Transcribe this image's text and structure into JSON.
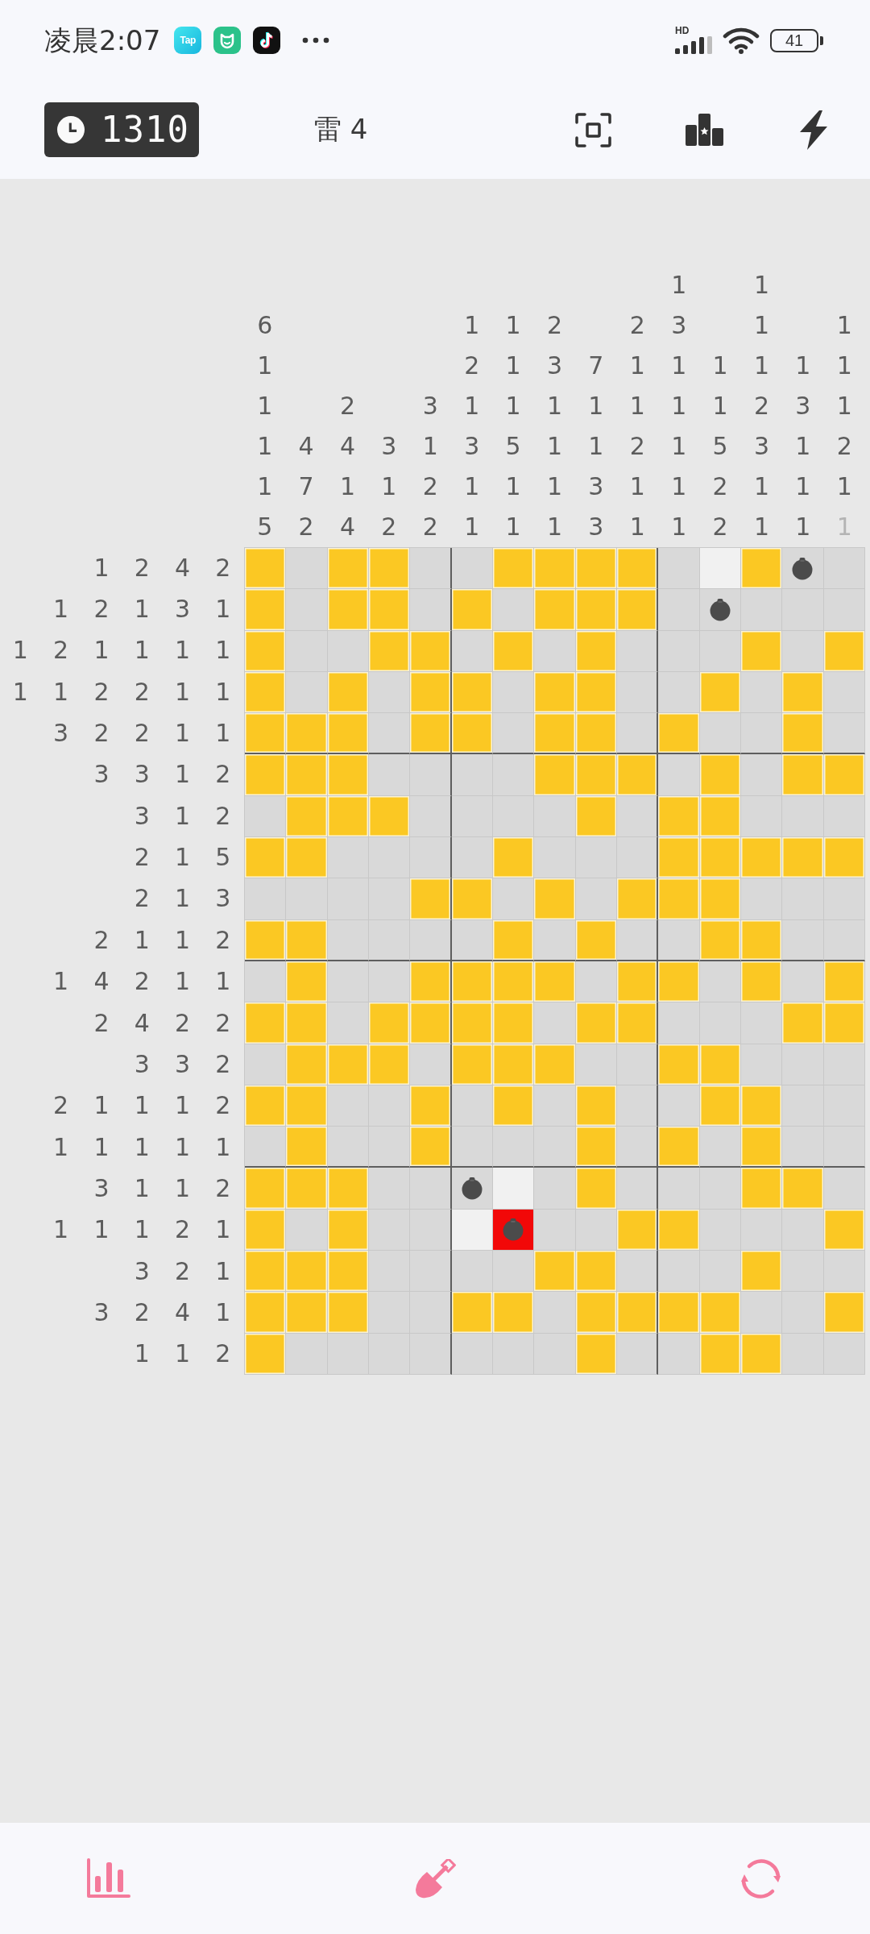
{
  "status_bar": {
    "time": "凌晨2:07",
    "app_label": "Tap",
    "network": "HD",
    "battery": "41"
  },
  "header": {
    "timer": "1310",
    "mines": "雷 4"
  },
  "puzzle": {
    "columns": [
      {
        "clues": [
          {
            "n": "6",
            "done": false
          },
          {
            "n": "1",
            "done": false
          },
          {
            "n": "1",
            "done": false
          },
          {
            "n": "1",
            "done": false
          },
          {
            "n": "1",
            "done": false
          },
          {
            "n": "5",
            "done": false
          }
        ]
      },
      {
        "clues": [
          {
            "n": "4",
            "done": false
          },
          {
            "n": "7",
            "done": false
          },
          {
            "n": "2",
            "done": false
          }
        ]
      },
      {
        "clues": [
          {
            "n": "2",
            "done": false
          },
          {
            "n": "4",
            "done": false
          },
          {
            "n": "1",
            "done": false
          },
          {
            "n": "4",
            "done": false
          }
        ]
      },
      {
        "clues": [
          {
            "n": "3",
            "done": false
          },
          {
            "n": "1",
            "done": false
          },
          {
            "n": "2",
            "done": false
          }
        ]
      },
      {
        "clues": [
          {
            "n": "3",
            "done": false
          },
          {
            "n": "1",
            "done": false
          },
          {
            "n": "2",
            "done": false
          },
          {
            "n": "2",
            "done": false
          }
        ]
      },
      {
        "clues": [
          {
            "n": "1",
            "done": false
          },
          {
            "n": "2",
            "done": false
          },
          {
            "n": "1",
            "done": false
          },
          {
            "n": "3",
            "done": false
          },
          {
            "n": "1",
            "done": false
          },
          {
            "n": "1",
            "done": false
          }
        ]
      },
      {
        "clues": [
          {
            "n": "1",
            "done": false
          },
          {
            "n": "1",
            "done": false
          },
          {
            "n": "1",
            "done": false
          },
          {
            "n": "5",
            "done": false
          },
          {
            "n": "1",
            "done": false
          },
          {
            "n": "1",
            "done": false
          }
        ]
      },
      {
        "clues": [
          {
            "n": "2",
            "done": false
          },
          {
            "n": "3",
            "done": false
          },
          {
            "n": "1",
            "done": false
          },
          {
            "n": "1",
            "done": false
          },
          {
            "n": "1",
            "done": false
          },
          {
            "n": "1",
            "done": false
          }
        ]
      },
      {
        "clues": [
          {
            "n": "7",
            "done": false
          },
          {
            "n": "1",
            "done": false
          },
          {
            "n": "1",
            "done": false
          },
          {
            "n": "3",
            "done": false
          },
          {
            "n": "3",
            "done": false
          }
        ]
      },
      {
        "clues": [
          {
            "n": "2",
            "done": false
          },
          {
            "n": "1",
            "done": false
          },
          {
            "n": "1",
            "done": false
          },
          {
            "n": "2",
            "done": false
          },
          {
            "n": "1",
            "done": false
          },
          {
            "n": "1",
            "done": false
          }
        ]
      },
      {
        "clues": [
          {
            "n": "1",
            "done": false
          },
          {
            "n": "3",
            "done": false
          },
          {
            "n": "1",
            "done": false
          },
          {
            "n": "1",
            "done": false
          },
          {
            "n": "1",
            "done": false
          },
          {
            "n": "1",
            "done": false
          },
          {
            "n": "1",
            "done": false
          }
        ]
      },
      {
        "clues": [
          {
            "n": "1",
            "done": false
          },
          {
            "n": "1",
            "done": false
          },
          {
            "n": "5",
            "done": false
          },
          {
            "n": "2",
            "done": false
          },
          {
            "n": "2",
            "done": false
          }
        ]
      },
      {
        "clues": [
          {
            "n": "1",
            "done": false
          },
          {
            "n": "1",
            "done": false
          },
          {
            "n": "1",
            "done": false
          },
          {
            "n": "2",
            "done": false
          },
          {
            "n": "3",
            "done": false
          },
          {
            "n": "1",
            "done": false
          },
          {
            "n": "1",
            "done": false
          }
        ]
      },
      {
        "clues": [
          {
            "n": "1",
            "done": false
          },
          {
            "n": "3",
            "done": false
          },
          {
            "n": "1",
            "done": false
          },
          {
            "n": "1",
            "done": false
          },
          {
            "n": "1",
            "done": false
          }
        ]
      },
      {
        "clues": [
          {
            "n": "1",
            "done": false
          },
          {
            "n": "1",
            "done": false
          },
          {
            "n": "1",
            "done": false
          },
          {
            "n": "2",
            "done": false
          },
          {
            "n": "1",
            "done": false
          },
          {
            "n": "1",
            "done": true
          }
        ]
      }
    ],
    "rows": [
      {
        "clues": [
          {
            "n": "1",
            "done": false
          },
          {
            "n": "2",
            "done": false
          },
          {
            "n": "4",
            "done": false
          },
          {
            "n": "2",
            "done": false
          }
        ],
        "cells": [
          {
            "kind": "filled"
          },
          {
            "kind": "blank"
          },
          {
            "kind": "filled"
          },
          {
            "kind": "filled"
          },
          {
            "kind": "blank"
          },
          {
            "kind": "blank"
          },
          {
            "kind": "filled"
          },
          {
            "kind": "filled"
          },
          {
            "kind": "filled"
          },
          {
            "kind": "filled"
          },
          {
            "kind": "blank"
          },
          {
            "kind": "open"
          },
          {
            "kind": "filled"
          },
          {
            "kind": "mine"
          },
          {
            "kind": "blank"
          }
        ]
      },
      {
        "clues": [
          {
            "n": "1",
            "done": false
          },
          {
            "n": "2",
            "done": false
          },
          {
            "n": "1",
            "done": false
          },
          {
            "n": "3",
            "done": false
          },
          {
            "n": "1",
            "done": false
          }
        ],
        "cells": [
          {
            "kind": "filled"
          },
          {
            "kind": "blank"
          },
          {
            "kind": "filled"
          },
          {
            "kind": "filled"
          },
          {
            "kind": "blank"
          },
          {
            "kind": "filled"
          },
          {
            "kind": "blank"
          },
          {
            "kind": "filled"
          },
          {
            "kind": "filled"
          },
          {
            "kind": "filled"
          },
          {
            "kind": "blank"
          },
          {
            "kind": "mine"
          },
          {
            "kind": "blank"
          },
          {
            "kind": "blank"
          },
          {
            "kind": "blank"
          }
        ]
      },
      {
        "clues": [
          {
            "n": "1",
            "done": false
          },
          {
            "n": "2",
            "done": false
          },
          {
            "n": "1",
            "done": false
          },
          {
            "n": "1",
            "done": false
          },
          {
            "n": "1",
            "done": false
          },
          {
            "n": "1",
            "done": false
          }
        ],
        "cells": [
          {
            "kind": "filled"
          },
          {
            "kind": "blank"
          },
          {
            "kind": "blank"
          },
          {
            "kind": "filled"
          },
          {
            "kind": "filled"
          },
          {
            "kind": "blank"
          },
          {
            "kind": "filled"
          },
          {
            "kind": "blank"
          },
          {
            "kind": "filled"
          },
          {
            "kind": "blank"
          },
          {
            "kind": "blank"
          },
          {
            "kind": "blank"
          },
          {
            "kind": "filled"
          },
          {
            "kind": "blank"
          },
          {
            "kind": "filled"
          }
        ]
      },
      {
        "clues": [
          {
            "n": "1",
            "done": false
          },
          {
            "n": "1",
            "done": false
          },
          {
            "n": "2",
            "done": false
          },
          {
            "n": "2",
            "done": false
          },
          {
            "n": "1",
            "done": false
          },
          {
            "n": "1",
            "done": false
          }
        ],
        "cells": [
          {
            "kind": "filled"
          },
          {
            "kind": "blank"
          },
          {
            "kind": "filled"
          },
          {
            "kind": "blank"
          },
          {
            "kind": "filled"
          },
          {
            "kind": "filled"
          },
          {
            "kind": "blank"
          },
          {
            "kind": "filled"
          },
          {
            "kind": "filled"
          },
          {
            "kind": "blank"
          },
          {
            "kind": "blank"
          },
          {
            "kind": "filled"
          },
          {
            "kind": "blank"
          },
          {
            "kind": "filled"
          },
          {
            "kind": "blank"
          }
        ]
      },
      {
        "clues": [
          {
            "n": "3",
            "done": false
          },
          {
            "n": "2",
            "done": false
          },
          {
            "n": "2",
            "done": false
          },
          {
            "n": "1",
            "done": false
          },
          {
            "n": "1",
            "done": false
          }
        ],
        "cells": [
          {
            "kind": "filled"
          },
          {
            "kind": "filled"
          },
          {
            "kind": "filled"
          },
          {
            "kind": "blank"
          },
          {
            "kind": "filled"
          },
          {
            "kind": "filled"
          },
          {
            "kind": "blank"
          },
          {
            "kind": "filled"
          },
          {
            "kind": "filled"
          },
          {
            "kind": "blank"
          },
          {
            "kind": "filled"
          },
          {
            "kind": "blank"
          },
          {
            "kind": "blank"
          },
          {
            "kind": "filled"
          },
          {
            "kind": "blank"
          }
        ]
      },
      {
        "clues": [
          {
            "n": "3",
            "done": false
          },
          {
            "n": "3",
            "done": false
          },
          {
            "n": "1",
            "done": false
          },
          {
            "n": "2",
            "done": false
          }
        ],
        "cells": [
          {
            "kind": "filled"
          },
          {
            "kind": "filled"
          },
          {
            "kind": "filled"
          },
          {
            "kind": "blank"
          },
          {
            "kind": "blank"
          },
          {
            "kind": "blank"
          },
          {
            "kind": "blank"
          },
          {
            "kind": "filled"
          },
          {
            "kind": "filled"
          },
          {
            "kind": "filled"
          },
          {
            "kind": "blank"
          },
          {
            "kind": "filled"
          },
          {
            "kind": "blank"
          },
          {
            "kind": "filled"
          },
          {
            "kind": "filled"
          }
        ]
      },
      {
        "clues": [
          {
            "n": "3",
            "done": false
          },
          {
            "n": "1",
            "done": false
          },
          {
            "n": "2",
            "done": false
          }
        ],
        "cells": [
          {
            "kind": "blank"
          },
          {
            "kind": "filled"
          },
          {
            "kind": "filled"
          },
          {
            "kind": "filled"
          },
          {
            "kind": "blank"
          },
          {
            "kind": "blank"
          },
          {
            "kind": "blank"
          },
          {
            "kind": "blank"
          },
          {
            "kind": "filled"
          },
          {
            "kind": "blank"
          },
          {
            "kind": "filled"
          },
          {
            "kind": "filled"
          },
          {
            "kind": "blank"
          },
          {
            "kind": "blank"
          },
          {
            "kind": "blank"
          }
        ]
      },
      {
        "clues": [
          {
            "n": "2",
            "done": false
          },
          {
            "n": "1",
            "done": false
          },
          {
            "n": "5",
            "done": false
          }
        ],
        "cells": [
          {
            "kind": "filled"
          },
          {
            "kind": "filled"
          },
          {
            "kind": "blank"
          },
          {
            "kind": "blank"
          },
          {
            "kind": "blank"
          },
          {
            "kind": "blank"
          },
          {
            "kind": "filled"
          },
          {
            "kind": "blank"
          },
          {
            "kind": "blank"
          },
          {
            "kind": "blank"
          },
          {
            "kind": "filled"
          },
          {
            "kind": "filled"
          },
          {
            "kind": "filled"
          },
          {
            "kind": "filled"
          },
          {
            "kind": "filled"
          }
        ]
      },
      {
        "clues": [
          {
            "n": "2",
            "done": false
          },
          {
            "n": "1",
            "done": false
          },
          {
            "n": "3",
            "done": false
          }
        ],
        "cells": [
          {
            "kind": "blank"
          },
          {
            "kind": "blank"
          },
          {
            "kind": "blank"
          },
          {
            "kind": "blank"
          },
          {
            "kind": "filled"
          },
          {
            "kind": "filled"
          },
          {
            "kind": "blank"
          },
          {
            "kind": "filled"
          },
          {
            "kind": "blank"
          },
          {
            "kind": "filled"
          },
          {
            "kind": "filled"
          },
          {
            "kind": "filled"
          },
          {
            "kind": "blank"
          },
          {
            "kind": "blank"
          },
          {
            "kind": "blank"
          }
        ]
      },
      {
        "clues": [
          {
            "n": "2",
            "done": false
          },
          {
            "n": "1",
            "done": false
          },
          {
            "n": "1",
            "done": false
          },
          {
            "n": "2",
            "done": false
          }
        ],
        "cells": [
          {
            "kind": "filled"
          },
          {
            "kind": "filled"
          },
          {
            "kind": "blank"
          },
          {
            "kind": "blank"
          },
          {
            "kind": "blank"
          },
          {
            "kind": "blank"
          },
          {
            "kind": "filled"
          },
          {
            "kind": "blank"
          },
          {
            "kind": "filled"
          },
          {
            "kind": "blank"
          },
          {
            "kind": "blank"
          },
          {
            "kind": "filled"
          },
          {
            "kind": "filled"
          },
          {
            "kind": "blank"
          },
          {
            "kind": "blank"
          }
        ]
      },
      {
        "clues": [
          {
            "n": "1",
            "done": false
          },
          {
            "n": "4",
            "done": false
          },
          {
            "n": "2",
            "done": false
          },
          {
            "n": "1",
            "done": false
          },
          {
            "n": "1",
            "done": false
          }
        ],
        "cells": [
          {
            "kind": "blank"
          },
          {
            "kind": "filled"
          },
          {
            "kind": "blank"
          },
          {
            "kind": "blank"
          },
          {
            "kind": "filled"
          },
          {
            "kind": "filled"
          },
          {
            "kind": "filled"
          },
          {
            "kind": "filled"
          },
          {
            "kind": "blank"
          },
          {
            "kind": "filled"
          },
          {
            "kind": "filled"
          },
          {
            "kind": "blank"
          },
          {
            "kind": "filled"
          },
          {
            "kind": "blank"
          },
          {
            "kind": "filled"
          }
        ]
      },
      {
        "clues": [
          {
            "n": "2",
            "done": false
          },
          {
            "n": "4",
            "done": false
          },
          {
            "n": "2",
            "done": false
          },
          {
            "n": "2",
            "done": false
          }
        ],
        "cells": [
          {
            "kind": "filled"
          },
          {
            "kind": "filled"
          },
          {
            "kind": "blank"
          },
          {
            "kind": "filled"
          },
          {
            "kind": "filled"
          },
          {
            "kind": "filled"
          },
          {
            "kind": "filled"
          },
          {
            "kind": "blank"
          },
          {
            "kind": "filled"
          },
          {
            "kind": "filled"
          },
          {
            "kind": "blank"
          },
          {
            "kind": "blank"
          },
          {
            "kind": "blank"
          },
          {
            "kind": "filled"
          },
          {
            "kind": "filled"
          }
        ]
      },
      {
        "clues": [
          {
            "n": "3",
            "done": false
          },
          {
            "n": "3",
            "done": false
          },
          {
            "n": "2",
            "done": false
          }
        ],
        "cells": [
          {
            "kind": "blank"
          },
          {
            "kind": "filled"
          },
          {
            "kind": "filled"
          },
          {
            "kind": "filled"
          },
          {
            "kind": "blank"
          },
          {
            "kind": "filled"
          },
          {
            "kind": "filled"
          },
          {
            "kind": "filled"
          },
          {
            "kind": "blank"
          },
          {
            "kind": "blank"
          },
          {
            "kind": "filled"
          },
          {
            "kind": "filled"
          },
          {
            "kind": "blank"
          },
          {
            "kind": "blank"
          },
          {
            "kind": "blank"
          }
        ]
      },
      {
        "clues": [
          {
            "n": "2",
            "done": false
          },
          {
            "n": "1",
            "done": false
          },
          {
            "n": "1",
            "done": false
          },
          {
            "n": "1",
            "done": false
          },
          {
            "n": "2",
            "done": false
          }
        ],
        "cells": [
          {
            "kind": "filled"
          },
          {
            "kind": "filled"
          },
          {
            "kind": "blank"
          },
          {
            "kind": "blank"
          },
          {
            "kind": "filled"
          },
          {
            "kind": "blank"
          },
          {
            "kind": "filled"
          },
          {
            "kind": "blank"
          },
          {
            "kind": "filled"
          },
          {
            "kind": "blank"
          },
          {
            "kind": "blank"
          },
          {
            "kind": "filled"
          },
          {
            "kind": "filled"
          },
          {
            "kind": "blank"
          },
          {
            "kind": "blank"
          }
        ]
      },
      {
        "clues": [
          {
            "n": "1",
            "done": false
          },
          {
            "n": "1",
            "done": false
          },
          {
            "n": "1",
            "done": false
          },
          {
            "n": "1",
            "done": false
          },
          {
            "n": "1",
            "done": false
          }
        ],
        "cells": [
          {
            "kind": "blank"
          },
          {
            "kind": "filled"
          },
          {
            "kind": "blank"
          },
          {
            "kind": "blank"
          },
          {
            "kind": "filled"
          },
          {
            "kind": "blank"
          },
          {
            "kind": "blank"
          },
          {
            "kind": "blank"
          },
          {
            "kind": "filled"
          },
          {
            "kind": "blank"
          },
          {
            "kind": "filled"
          },
          {
            "kind": "blank"
          },
          {
            "kind": "filled"
          },
          {
            "kind": "blank"
          },
          {
            "kind": "blank"
          }
        ]
      },
      {
        "clues": [
          {
            "n": "3",
            "done": false
          },
          {
            "n": "1",
            "done": false
          },
          {
            "n": "1",
            "done": false
          },
          {
            "n": "2",
            "done": false
          }
        ],
        "cells": [
          {
            "kind": "filled"
          },
          {
            "kind": "filled"
          },
          {
            "kind": "filled"
          },
          {
            "kind": "blank"
          },
          {
            "kind": "blank"
          },
          {
            "kind": "mine"
          },
          {
            "kind": "open"
          },
          {
            "kind": "blank"
          },
          {
            "kind": "filled"
          },
          {
            "kind": "blank"
          },
          {
            "kind": "blank"
          },
          {
            "kind": "blank"
          },
          {
            "kind": "filled"
          },
          {
            "kind": "filled"
          },
          {
            "kind": "blank"
          }
        ]
      },
      {
        "clues": [
          {
            "n": "1",
            "done": false
          },
          {
            "n": "1",
            "done": false
          },
          {
            "n": "1",
            "done": false
          },
          {
            "n": "2",
            "done": false
          },
          {
            "n": "1",
            "done": false
          }
        ],
        "cells": [
          {
            "kind": "filled"
          },
          {
            "kind": "blank"
          },
          {
            "kind": "filled"
          },
          {
            "kind": "blank"
          },
          {
            "kind": "blank"
          },
          {
            "kind": "open"
          },
          {
            "kind": "exploded"
          },
          {
            "kind": "blank"
          },
          {
            "kind": "blank"
          },
          {
            "kind": "filled"
          },
          {
            "kind": "filled"
          },
          {
            "kind": "blank"
          },
          {
            "kind": "blank"
          },
          {
            "kind": "blank"
          },
          {
            "kind": "filled"
          }
        ]
      },
      {
        "clues": [
          {
            "n": "3",
            "done": false
          },
          {
            "n": "2",
            "done": false
          },
          {
            "n": "1",
            "done": false
          }
        ],
        "cells": [
          {
            "kind": "filled"
          },
          {
            "kind": "filled"
          },
          {
            "kind": "filled"
          },
          {
            "kind": "blank"
          },
          {
            "kind": "blank"
          },
          {
            "kind": "blank"
          },
          {
            "kind": "blank"
          },
          {
            "kind": "filled"
          },
          {
            "kind": "filled"
          },
          {
            "kind": "blank"
          },
          {
            "kind": "blank"
          },
          {
            "kind": "blank"
          },
          {
            "kind": "filled"
          },
          {
            "kind": "blank"
          },
          {
            "kind": "blank"
          }
        ]
      },
      {
        "clues": [
          {
            "n": "3",
            "done": false
          },
          {
            "n": "2",
            "done": false
          },
          {
            "n": "4",
            "done": false
          },
          {
            "n": "1",
            "done": false
          }
        ],
        "cells": [
          {
            "kind": "filled"
          },
          {
            "kind": "filled"
          },
          {
            "kind": "filled"
          },
          {
            "kind": "blank"
          },
          {
            "kind": "blank"
          },
          {
            "kind": "filled"
          },
          {
            "kind": "filled"
          },
          {
            "kind": "blank"
          },
          {
            "kind": "filled"
          },
          {
            "kind": "filled"
          },
          {
            "kind": "filled"
          },
          {
            "kind": "filled"
          },
          {
            "kind": "blank"
          },
          {
            "kind": "blank"
          },
          {
            "kind": "filled"
          }
        ]
      },
      {
        "clues": [
          {
            "n": "1",
            "done": false
          },
          {
            "n": "1",
            "done": false
          },
          {
            "n": "2",
            "done": false
          }
        ],
        "cells": [
          {
            "kind": "filled"
          },
          {
            "kind": "blank"
          },
          {
            "kind": "blank"
          },
          {
            "kind": "blank"
          },
          {
            "kind": "blank"
          },
          {
            "kind": "blank"
          },
          {
            "kind": "blank"
          },
          {
            "kind": "blank"
          },
          {
            "kind": "filled"
          },
          {
            "kind": "blank"
          },
          {
            "kind": "blank"
          },
          {
            "kind": "filled"
          },
          {
            "kind": "filled"
          },
          {
            "kind": "blank"
          },
          {
            "kind": "blank"
          }
        ]
      }
    ]
  }
}
